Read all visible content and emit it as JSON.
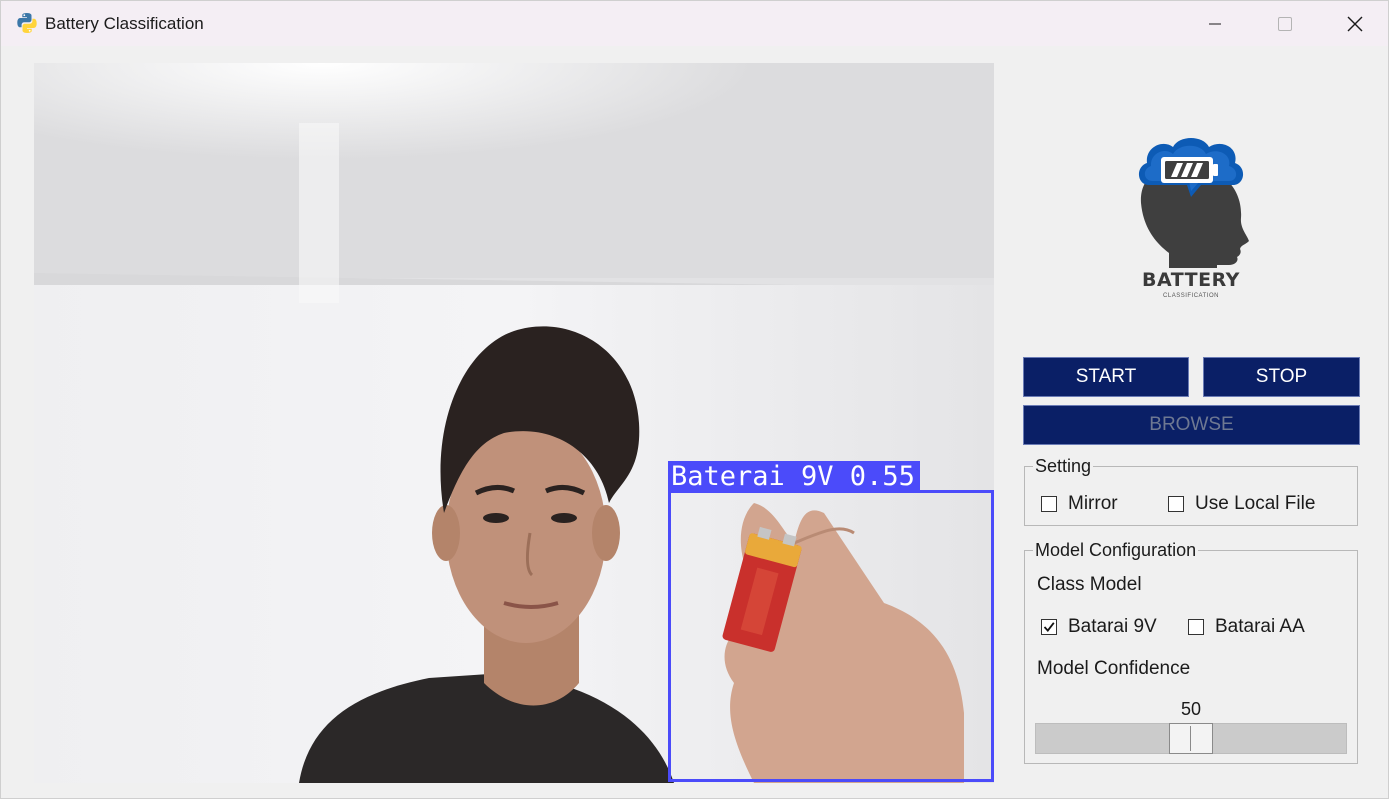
{
  "window": {
    "title": "Battery Classification",
    "app_icon": "python-icon"
  },
  "video": {
    "detection": {
      "label": "Baterai 9V 0.55",
      "confidence": 0.55,
      "color": "#4b4bfa"
    }
  },
  "logo": {
    "title": "BATTERY",
    "subtitle": "CLASSIFICATION",
    "icon": "head-battery-cloud-icon",
    "color": "#0d5bb5"
  },
  "buttons": {
    "start": "START",
    "stop": "STOP",
    "browse": "BROWSE",
    "color": "#0a1f66"
  },
  "setting": {
    "title": "Setting",
    "mirror": {
      "label": "Mirror",
      "checked": false
    },
    "use_local_file": {
      "label": "Use Local File",
      "checked": false
    }
  },
  "model_config": {
    "title": "Model Configuration",
    "class_model_label": "Class Model",
    "classes": [
      {
        "label": "Batarai 9V",
        "checked": true
      },
      {
        "label": "Batarai AA",
        "checked": false
      }
    ],
    "confidence_label": "Model Confidence",
    "confidence_value": "50",
    "slider_min": 0,
    "slider_max": 100
  }
}
